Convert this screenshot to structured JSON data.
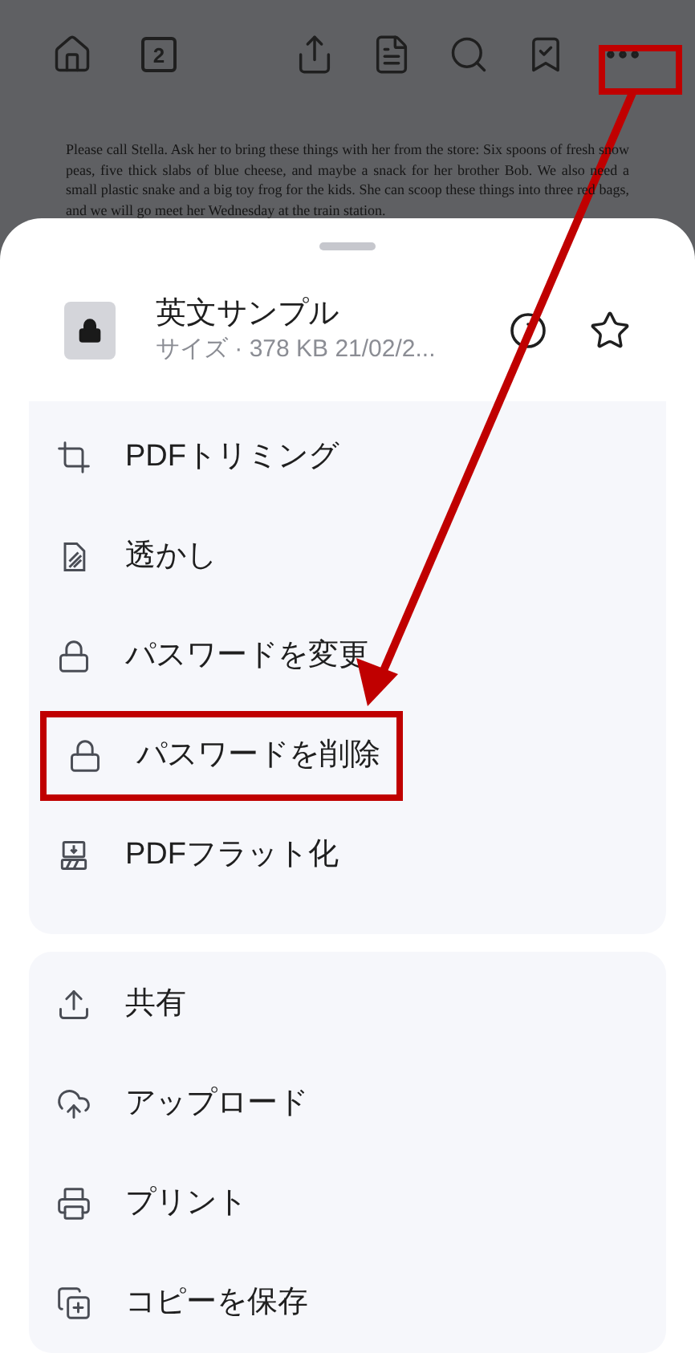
{
  "toolbar": {
    "page": "2",
    "more_highlighted": true
  },
  "document": {
    "text": "Please call Stella. Ask her to bring these things with her from the store: Six spoons of fresh snow peas, five thick slabs of blue cheese, and maybe a snack for her brother Bob. We also need a small plastic snake and a big toy frog for the kids. She can scoop these things into three red bags, and we will go meet her Wednesday at the train station."
  },
  "file": {
    "title": "英文サンプル",
    "subtitle": "サイズ · 378 KB 21/02/2..."
  },
  "menu_groups": [
    {
      "items": [
        {
          "label": "PDFトリミング",
          "highlighted": false
        },
        {
          "label": "透かし",
          "highlighted": false
        },
        {
          "label": "パスワードを変更",
          "highlighted": false
        },
        {
          "label": "パスワードを削除",
          "highlighted": true
        },
        {
          "label": "PDFフラット化",
          "highlighted": false
        }
      ]
    },
    {
      "items": [
        {
          "label": "共有",
          "highlighted": false
        },
        {
          "label": "アップロード",
          "highlighted": false
        },
        {
          "label": "プリント",
          "highlighted": false
        },
        {
          "label": "コピーを保存",
          "highlighted": false
        }
      ]
    }
  ]
}
